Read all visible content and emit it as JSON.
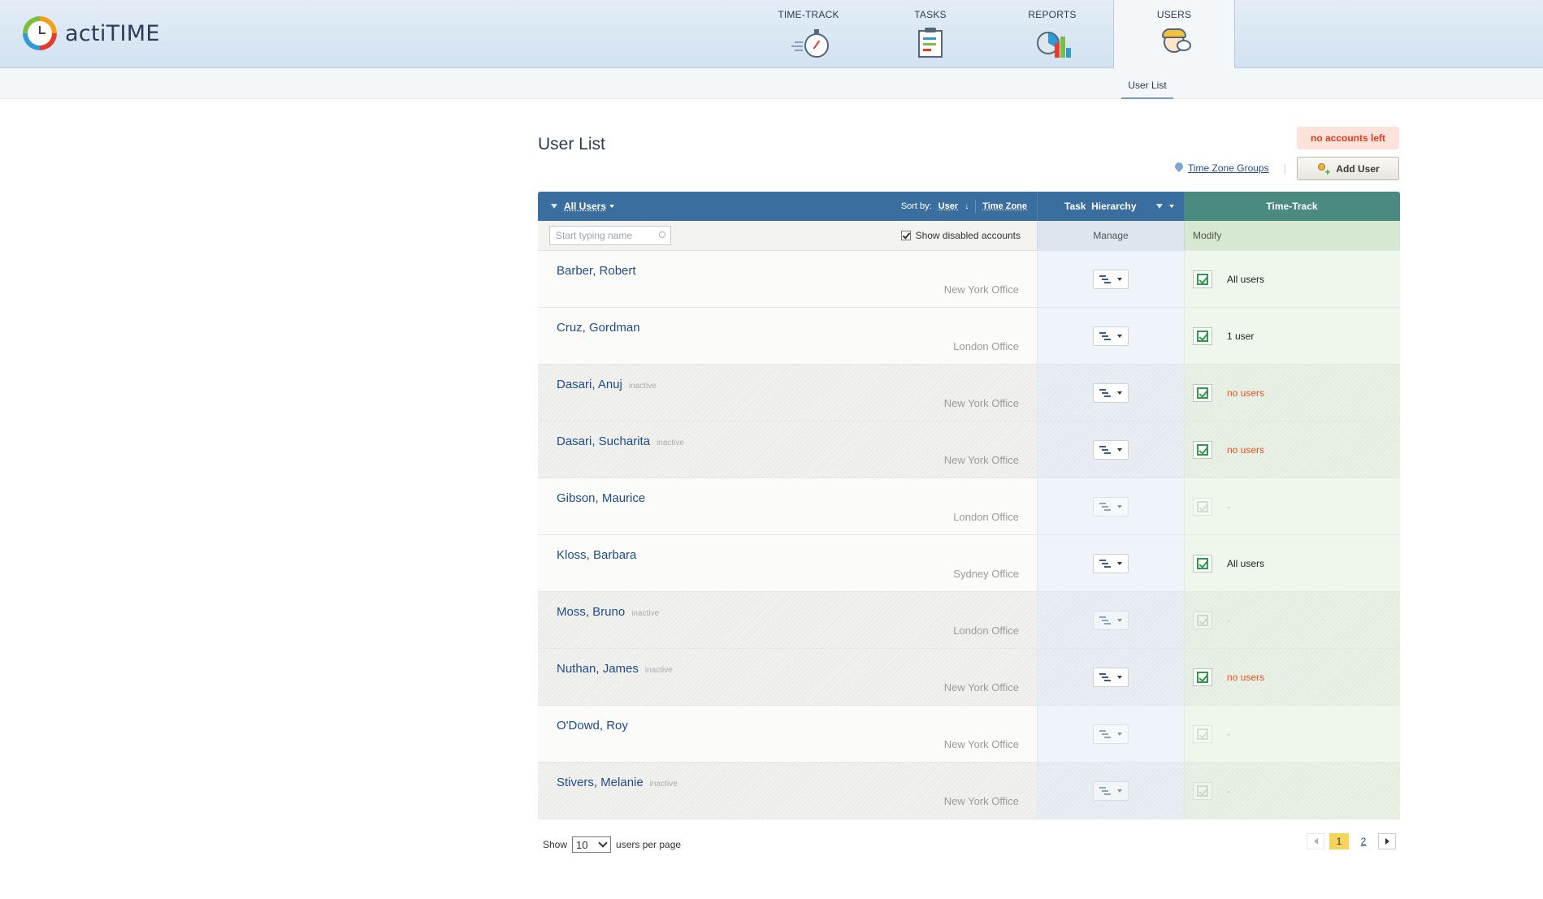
{
  "app": {
    "name": "actiTIME"
  },
  "nav": [
    {
      "label": "TIME-TRACK",
      "icon": "stopwatch-icon",
      "active": false
    },
    {
      "label": "TASKS",
      "icon": "tasks-icon",
      "active": false
    },
    {
      "label": "REPORTS",
      "icon": "reports-icon",
      "active": false
    },
    {
      "label": "USERS",
      "icon": "users-icon",
      "active": true
    }
  ],
  "subnav": {
    "active_tab": "User List"
  },
  "page": {
    "title": "User List",
    "accounts_badge": "no accounts left",
    "time_zone_groups": "Time Zone Groups",
    "add_user": "Add User"
  },
  "table": {
    "header": {
      "filter": "All Users",
      "sort_by_label": "Sort by:",
      "sort_user": "User",
      "sort_timezone": "Time Zone",
      "task_hierarchy": "Task  Hierarchy",
      "time_track": "Time-Track"
    },
    "subheader": {
      "search_placeholder": "Start typing name",
      "show_disabled": "Show disabled accounts",
      "manage": "Manage",
      "modify": "Modify"
    },
    "inactive_label": "inactive",
    "rows": [
      {
        "name": "Barber, Robert",
        "inactive": false,
        "office": "New York Office",
        "manage_enabled": true,
        "modify_enabled": true,
        "modify_text": "All users"
      },
      {
        "name": "Cruz, Gordman",
        "inactive": false,
        "office": "London Office",
        "manage_enabled": true,
        "modify_enabled": true,
        "modify_text": "1 user"
      },
      {
        "name": "Dasari, Anuj",
        "inactive": true,
        "office": "New York Office",
        "manage_enabled": true,
        "modify_enabled": true,
        "modify_text": "no users"
      },
      {
        "name": "Dasari, Sucharita",
        "inactive": true,
        "office": "New York Office",
        "manage_enabled": true,
        "modify_enabled": true,
        "modify_text": "no users"
      },
      {
        "name": "Gibson, Maurice",
        "inactive": false,
        "office": "London Office",
        "manage_enabled": false,
        "modify_enabled": false,
        "modify_text": "-"
      },
      {
        "name": "Kloss, Barbara",
        "inactive": false,
        "office": "Sydney Office",
        "manage_enabled": true,
        "modify_enabled": true,
        "modify_text": "All users"
      },
      {
        "name": "Moss, Bruno",
        "inactive": true,
        "office": "London Office",
        "manage_enabled": false,
        "modify_enabled": false,
        "modify_text": "-"
      },
      {
        "name": "Nuthan, James",
        "inactive": true,
        "office": "New York Office",
        "manage_enabled": true,
        "modify_enabled": true,
        "modify_text": "no users"
      },
      {
        "name": "O'Dowd, Roy",
        "inactive": false,
        "office": "New York Office",
        "manage_enabled": false,
        "modify_enabled": false,
        "modify_text": "-"
      },
      {
        "name": "Stivers, Melanie",
        "inactive": true,
        "office": "New York Office",
        "manage_enabled": false,
        "modify_enabled": false,
        "modify_text": "-"
      }
    ]
  },
  "footer": {
    "show_label": "Show",
    "per_page_value": "10",
    "per_page_suffix": "users per page",
    "pages": [
      "1",
      "2"
    ],
    "current_page": "1"
  },
  "colors": {
    "header_blue": "#3a6e9e",
    "header_green": "#4a8a7f",
    "link": "#1f4c8a",
    "warning_red": "#e43b1d",
    "no_users_orange": "#e5531a",
    "current_page": "#f6d35a"
  }
}
